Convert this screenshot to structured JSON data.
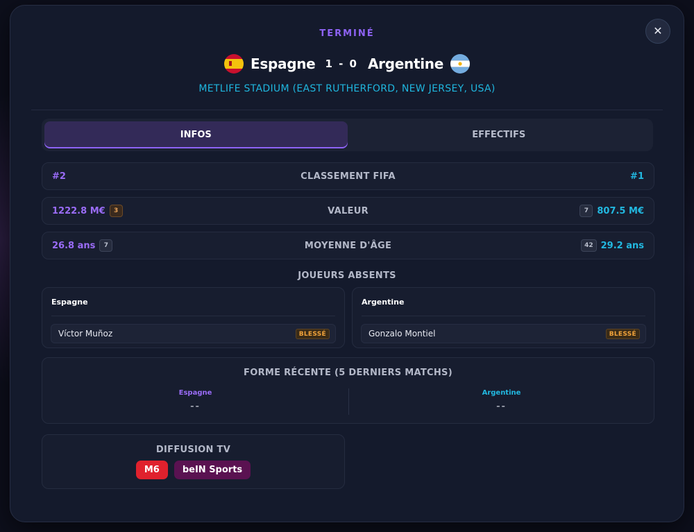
{
  "match": {
    "status": "TERMINÉ",
    "home_team": "Espagne",
    "away_team": "Argentine",
    "score": "1 - 0",
    "venue": "METLIFE STADIUM (EAST RUTHERFORD, NEW JERSEY, USA)",
    "close_label": "✕"
  },
  "tabs": [
    {
      "label": "INFOS",
      "active": true
    },
    {
      "label": "EFFECTIFS",
      "active": false
    }
  ],
  "stats": {
    "fifa": {
      "label": "CLASSEMENT FIFA",
      "left": "#2",
      "right": "#1"
    },
    "value": {
      "label": "VALEUR",
      "left": "1222.8 M€",
      "left_rank": "3",
      "right": "807.5 M€",
      "right_rank": "7"
    },
    "age": {
      "label": "MOYENNE D'ÂGE",
      "left": "26.8 ans",
      "left_rank": "7",
      "right": "29.2 ans",
      "right_rank": "42"
    }
  },
  "absent": {
    "title": "JOUEURS ABSENTS",
    "home": {
      "team": "Espagne",
      "player": "Víctor Muñoz",
      "status": "BLESSÉ"
    },
    "away": {
      "team": "Argentine",
      "player": "Gonzalo Montiel",
      "status": "BLESSÉ"
    }
  },
  "form": {
    "title": "FORME RÉCENTE (5 DERNIERS MATCHS)",
    "home": {
      "team": "Espagne",
      "value": "--"
    },
    "away": {
      "team": "Argentine",
      "value": "--"
    }
  },
  "tv": {
    "title": "DIFFUSION TV",
    "channels": [
      {
        "name": "M6",
        "color": "#e0212d"
      },
      {
        "name": "beIN Sports",
        "color": "#5a1251"
      }
    ]
  },
  "colors": {
    "accent_purple": "#8e63f5",
    "accent_cyan": "#1fb6de",
    "injury_orange": "#f2a33a"
  },
  "icons": {
    "home_flag": "spain-flag-icon",
    "away_flag": "argentina-flag-icon",
    "close": "close-icon"
  }
}
